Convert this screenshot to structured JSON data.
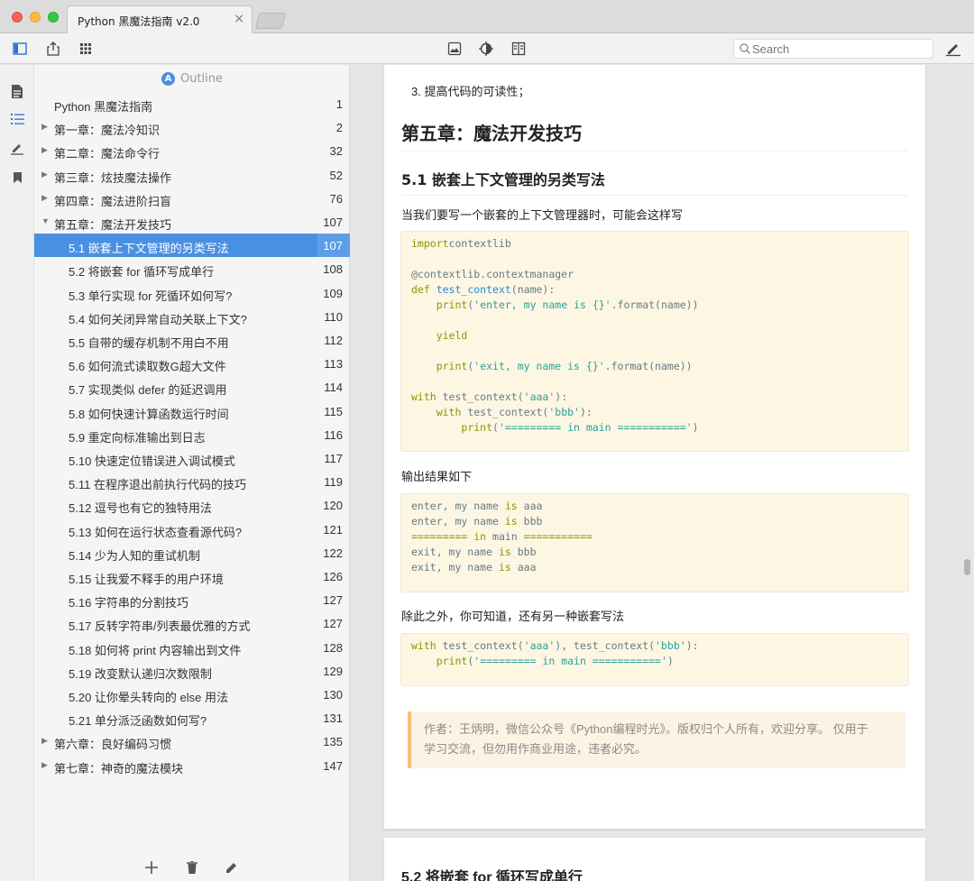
{
  "window": {
    "tab_title": "Python 黑魔法指南 v2.0",
    "tab_close": "×"
  },
  "search": {
    "placeholder": "Search"
  },
  "outline": {
    "header_badge": "A",
    "header_label": "Outline",
    "items": [
      {
        "label": "Python 黑魔法指南",
        "page": "1",
        "level": 0,
        "toggle": ""
      },
      {
        "label": "第一章：魔法冷知识",
        "page": "2",
        "level": 0,
        "toggle": "▶"
      },
      {
        "label": "第二章：魔法命令行",
        "page": "32",
        "level": 0,
        "toggle": "▶"
      },
      {
        "label": "第三章：炫技魔法操作",
        "page": "52",
        "level": 0,
        "toggle": "▶"
      },
      {
        "label": "第四章：魔法进阶扫盲",
        "page": "76",
        "level": 0,
        "toggle": "▶"
      },
      {
        "label": "第五章：魔法开发技巧",
        "page": "107",
        "level": 0,
        "toggle": "▼"
      },
      {
        "label": "5.1 嵌套上下文管理的另类写法",
        "page": "107",
        "level": 1,
        "selected": true
      },
      {
        "label": "5.2 将嵌套 for 循环写成单行",
        "page": "108",
        "level": 1
      },
      {
        "label": "5.3 单行实现 for 死循环如何写?",
        "page": "109",
        "level": 1
      },
      {
        "label": "5.4 如何关闭异常自动关联上下文?",
        "page": "110",
        "level": 1
      },
      {
        "label": "5.5 自带的缓存机制不用白不用",
        "page": "112",
        "level": 1
      },
      {
        "label": "5.6 如何流式读取数G超大文件",
        "page": "113",
        "level": 1
      },
      {
        "label": "5.7 实现类似 defer 的延迟调用",
        "page": "114",
        "level": 1
      },
      {
        "label": "5.8 如何快速计算函数运行时间",
        "page": "115",
        "level": 1
      },
      {
        "label": "5.9 重定向标准输出到日志",
        "page": "116",
        "level": 1
      },
      {
        "label": "5.10 快速定位错误进入调试模式",
        "page": "117",
        "level": 1
      },
      {
        "label": "5.11 在程序退出前执行代码的技巧",
        "page": "119",
        "level": 1
      },
      {
        "label": "5.12 逗号也有它的独特用法",
        "page": "120",
        "level": 1
      },
      {
        "label": "5.13 如何在运行状态查看源代码?",
        "page": "121",
        "level": 1
      },
      {
        "label": "5.14 少为人知的重试机制",
        "page": "122",
        "level": 1
      },
      {
        "label": "5.15 让我爱不释手的用户环境",
        "page": "126",
        "level": 1
      },
      {
        "label": "5.16 字符串的分割技巧",
        "page": "127",
        "level": 1
      },
      {
        "label": "5.17 反转字符串/列表最优雅的方式",
        "page": "127",
        "level": 1
      },
      {
        "label": "5.18  如何将 print 内容输出到文件",
        "page": "128",
        "level": 1
      },
      {
        "label": "5.19 改变默认递归次数限制",
        "page": "129",
        "level": 1
      },
      {
        "label": "5.20 让你晕头转向的 else 用法",
        "page": "130",
        "level": 1
      },
      {
        "label": "5.21 单分派泛函数如何写?",
        "page": "131",
        "level": 1
      },
      {
        "label": "第六章：良好编码习惯",
        "page": "135",
        "level": 0,
        "toggle": "▶"
      },
      {
        "label": "第七章：神奇的魔法模块",
        "page": "147",
        "level": 0,
        "toggle": "▶"
      }
    ]
  },
  "document": {
    "list_item": "3.  提高代码的可读性；",
    "h1": "第五章：魔法开发技巧",
    "h2": "5.1 嵌套上下文管理的另类写法",
    "para1": "当我们要写一个嵌套的上下文管理器时，可能会这样写",
    "para2": "输出结果如下",
    "para3": "除此之外，你可知道，还有另一种嵌套写法",
    "quote_line1": "作者：王炳明，微信公众号《Python编程时光》。版权归个人所有，欢迎分享。 仅用于",
    "quote_line2": "学习交流，但勿用作商业用途，违者必究。",
    "next_heading": "5.2 将嵌套 for 循环写成单行",
    "code1": [
      [
        [
          "kw",
          "import"
        ],
        [
          "",
          "contextlib"
        ]
      ],
      [],
      [
        [
          "",
          "@contextlib.contextmanager"
        ]
      ],
      [
        [
          "kw",
          "def "
        ],
        [
          "fn",
          "test_context"
        ],
        [
          "",
          "(name):"
        ]
      ],
      [
        [
          "",
          "    "
        ],
        [
          "kw",
          "print"
        ],
        [
          "",
          "("
        ],
        [
          "str",
          "'enter, my name is {}'"
        ],
        [
          "",
          ".format(name))"
        ]
      ],
      [],
      [
        [
          "",
          "    "
        ],
        [
          "kw",
          "yield"
        ]
      ],
      [],
      [
        [
          "",
          "    "
        ],
        [
          "kw",
          "print"
        ],
        [
          "",
          "("
        ],
        [
          "str",
          "'exit, my name is {}'"
        ],
        [
          "",
          ".format(name))"
        ]
      ],
      [],
      [
        [
          "kw",
          "with "
        ],
        [
          "",
          "test_context("
        ],
        [
          "str",
          "'aaa'"
        ],
        [
          "",
          "):"
        ]
      ],
      [
        [
          "",
          "    "
        ],
        [
          "kw",
          "with "
        ],
        [
          "",
          "test_context("
        ],
        [
          "str",
          "'bbb'"
        ],
        [
          "",
          "):"
        ]
      ],
      [
        [
          "",
          "        "
        ],
        [
          "kw",
          "print"
        ],
        [
          "",
          "("
        ],
        [
          "str",
          "'========= in main ==========='"
        ],
        [
          "",
          ")"
        ]
      ]
    ],
    "code2": [
      [
        [
          "",
          "enter, my name "
        ],
        [
          "kw",
          "is"
        ],
        [
          "",
          " aaa"
        ]
      ],
      [
        [
          "",
          "enter, my name "
        ],
        [
          "kw",
          "is"
        ],
        [
          "",
          " bbb"
        ]
      ],
      [
        [
          "kw",
          "========="
        ],
        [
          "kw",
          " in"
        ],
        [
          "",
          " main "
        ],
        [
          "kw",
          "==========="
        ]
      ],
      [
        [
          "",
          "exit, my name "
        ],
        [
          "kw",
          "is"
        ],
        [
          "",
          " bbb"
        ]
      ],
      [
        [
          "",
          "exit, my name "
        ],
        [
          "kw",
          "is"
        ],
        [
          "",
          " aaa"
        ]
      ]
    ],
    "code3": [
      [
        [
          "kw",
          "with "
        ],
        [
          "",
          "test_context("
        ],
        [
          "str",
          "'aaa'"
        ],
        [
          "",
          "), test_context("
        ],
        [
          "str",
          "'bbb'"
        ],
        [
          "",
          "):"
        ]
      ],
      [
        [
          "",
          "    "
        ],
        [
          "kw",
          "print"
        ],
        [
          "",
          "("
        ],
        [
          "str",
          "'========= in main ==========='"
        ],
        [
          "",
          ")"
        ]
      ]
    ]
  }
}
